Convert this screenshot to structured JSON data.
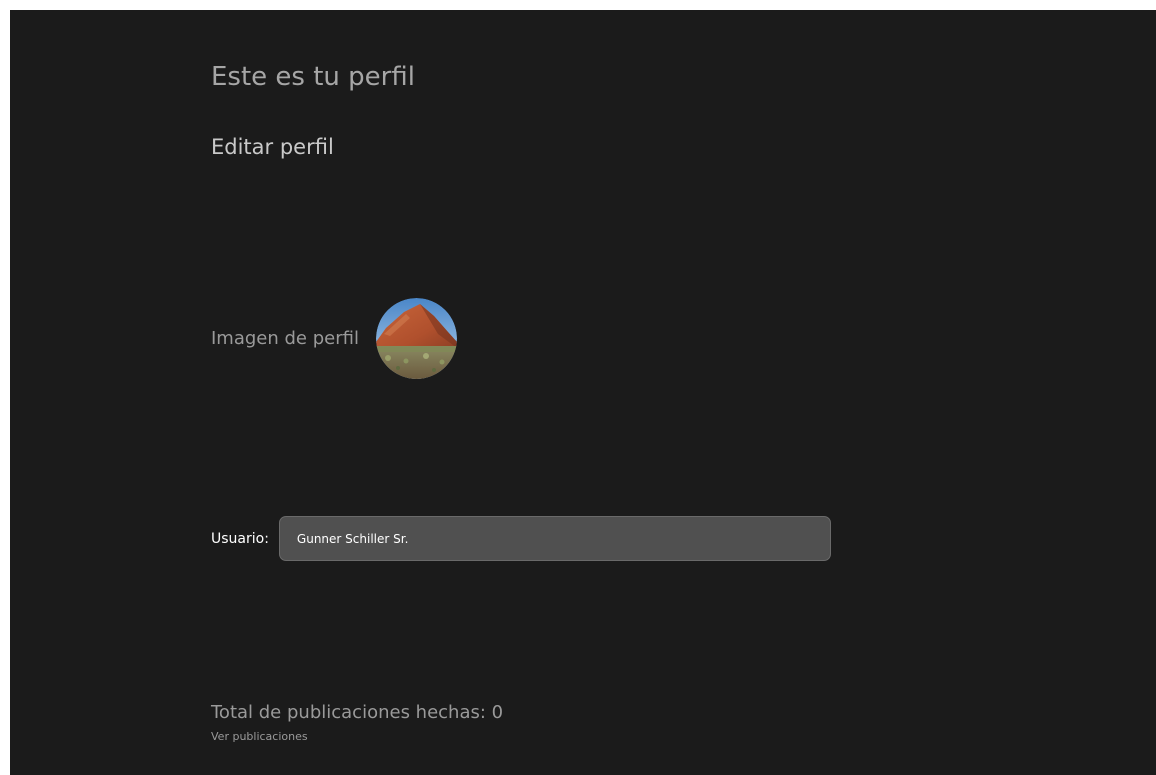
{
  "page": {
    "title": "Este es tu perfil",
    "edit_title": "Editar perfil"
  },
  "profile": {
    "image_label": "Imagen de perfil",
    "avatar_icon": "profile-photo-desert-rock",
    "username_label": "Usuario:",
    "username_value": "Gunner Schiller Sr."
  },
  "posts": {
    "total_text": "Total de publicaciones hechas: 0",
    "view_link": "Ver publicaciones"
  },
  "colors": {
    "background": "#1b1b1b",
    "input_background": "#505050",
    "muted_text": "#9a9a9a"
  }
}
